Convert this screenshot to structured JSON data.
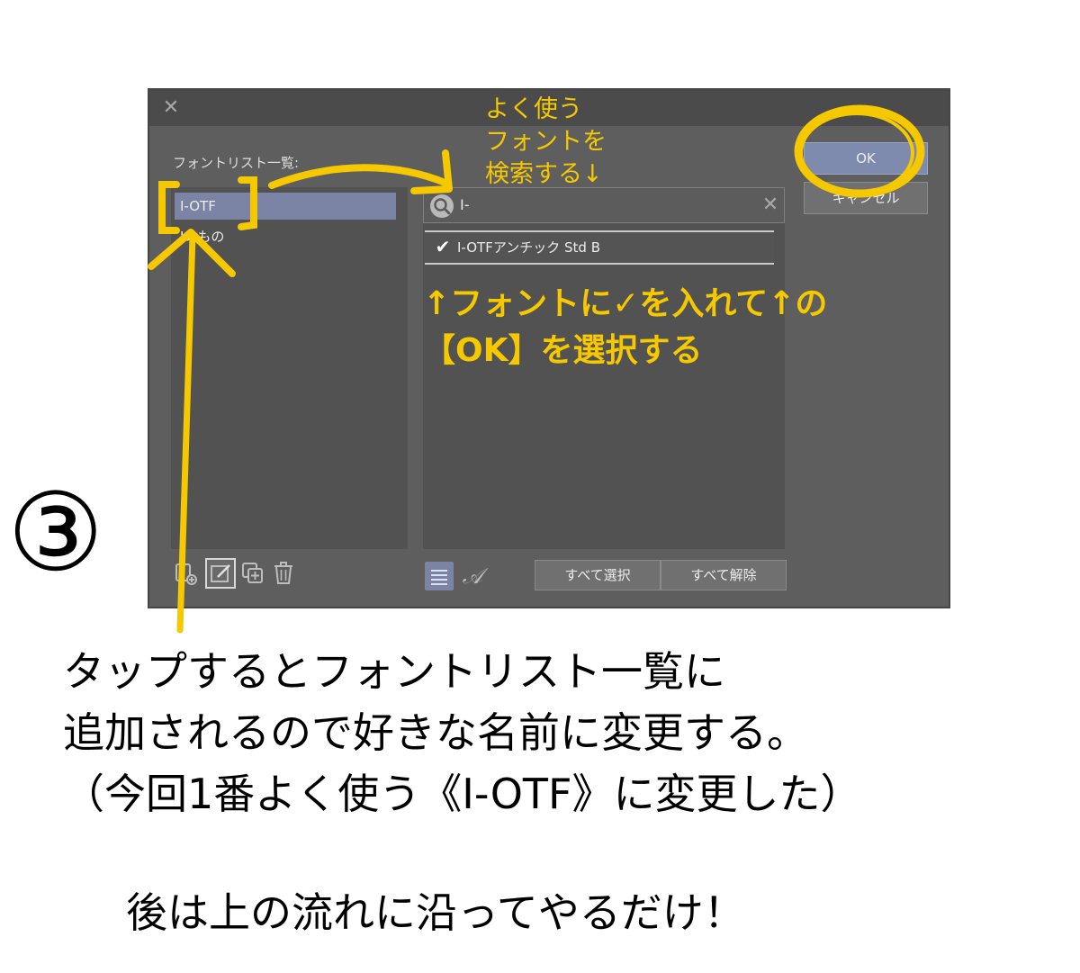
{
  "dialog": {
    "font_list_title": "フォントリスト一覧:",
    "left_items": [
      {
        "label": "I-OTF",
        "selected": true
      },
      {
        "label": "Iのもの",
        "selected": false
      }
    ],
    "search": {
      "value": "I-"
    },
    "font_results": [
      {
        "name": "I-OTFアンチック Std B",
        "checked": true
      }
    ],
    "buttons": {
      "ok": "OK",
      "cancel": "キャンセル",
      "select_all": "すべて選択",
      "deselect_all": "すべて解除"
    },
    "icons": {
      "close": "close-icon",
      "search": "search-icon",
      "clear": "clear-icon",
      "check": "check-icon",
      "new_list": "new-list-icon",
      "edit": "edit-icon",
      "duplicate": "duplicate-icon",
      "delete": "trash-icon",
      "list_view": "list-view-icon",
      "preview": "font-preview-icon"
    }
  },
  "annotations": {
    "search_note": [
      "よく使う",
      "フォントを",
      "検索する↓"
    ],
    "check_note": [
      "↑フォントに✓を入れて↑の",
      "【OK】を選択する"
    ],
    "circled_number": "③",
    "bottom_text_lines": [
      "タップするとフォントリスト一覧に",
      "追加されるので好きな名前に変更する。",
      "（今回1番よく使う《I-OTF》に変更した）"
    ],
    "closing_text": "後は上の流れに沿ってやるだけ！"
  },
  "colors": {
    "annotation_yellow": "#f5c800",
    "dialog_bg": "#5e5e5e",
    "selection_blue": "#7b84a4"
  }
}
